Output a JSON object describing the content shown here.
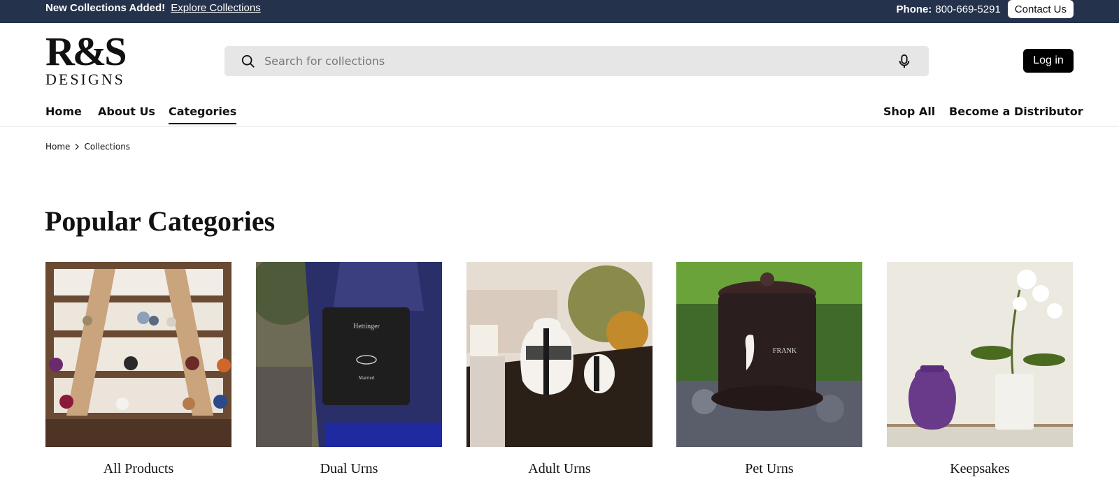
{
  "announcement": {
    "prefix": "New Collections Added!",
    "link": "Explore Collections",
    "phone_label": "Phone:",
    "phone_number": "800-669-5291",
    "contact_button": "Contact Us"
  },
  "header": {
    "logo_main": "R&S",
    "logo_sub": "DESIGNS",
    "search_placeholder": "Search for collections",
    "login": "Log in"
  },
  "nav": {
    "left": [
      "Home",
      "About Us",
      "Categories"
    ],
    "right": [
      "Shop All",
      "Become a Distributor"
    ],
    "active": "Categories"
  },
  "breadcrumb": [
    "Home",
    "Collections"
  ],
  "section_title": "Popular Categories",
  "categories": [
    {
      "label": "All Products"
    },
    {
      "label": "Dual Urns"
    },
    {
      "label": "Adult Urns"
    },
    {
      "label": "Pet Urns"
    },
    {
      "label": "Keepsakes"
    }
  ],
  "icons": {
    "search": "search-icon",
    "mic": "microphone-icon",
    "chevron": "chevron-right-icon"
  },
  "colors": {
    "announcement_bg": "#24324b",
    "search_bg": "#e6e6e6",
    "login_bg": "#000000"
  }
}
